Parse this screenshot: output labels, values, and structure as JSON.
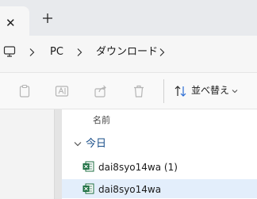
{
  "tabs": {
    "close_glyph": "✕",
    "new_tab_glyph": "+"
  },
  "breadcrumb": {
    "items": [
      "PC",
      "ダウンロード"
    ]
  },
  "toolbar": {
    "sort_label": "並べ替え",
    "icons": [
      "clipboard-icon",
      "rename-icon",
      "share-icon",
      "delete-icon",
      "sort-icon"
    ]
  },
  "file_list": {
    "column_header": "名前",
    "group_label": "今日",
    "files": [
      {
        "name": "dai8syo14wa (1)",
        "selected": false
      },
      {
        "name": "dai8syo14wa",
        "selected": true
      }
    ]
  },
  "colors": {
    "excel_green": "#1d6f42",
    "selection": "#e3eefb",
    "group_blue": "#1a4f8a"
  }
}
